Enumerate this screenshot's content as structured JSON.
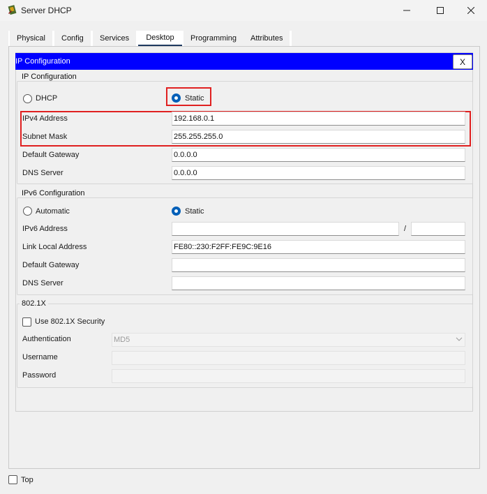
{
  "window": {
    "title": "Server DHCP"
  },
  "tabs": [
    {
      "label": "Physical"
    },
    {
      "label": "Config"
    },
    {
      "label": "Services"
    },
    {
      "label": "Desktop"
    },
    {
      "label": "Programming"
    },
    {
      "label": "Attributes"
    }
  ],
  "active_tab": "Desktop",
  "header": {
    "title": "IP Configuration",
    "close_label": "X"
  },
  "ipv4": {
    "group_title": "IP Configuration",
    "dhcp_label": "DHCP",
    "static_label": "Static",
    "selected": "Static",
    "ipv4_label": "IPv4 Address",
    "ipv4_value": "192.168.0.1",
    "subnet_label": "Subnet Mask",
    "subnet_value": "255.255.255.0",
    "gateway_label": "Default Gateway",
    "gateway_value": "0.0.0.0",
    "dns_label": "DNS Server",
    "dns_value": "0.0.0.0"
  },
  "ipv6": {
    "group_title": "IPv6 Configuration",
    "automatic_label": "Automatic",
    "static_label": "Static",
    "selected": "Static",
    "address_label": "IPv6 Address",
    "address_value": "",
    "prefix_separator": "/",
    "prefix_value": "",
    "link_local_label": "Link Local Address",
    "link_local_value": "FE80::230:F2FF:FE9C:9E16",
    "gateway_label": "Default Gateway",
    "gateway_value": "",
    "dns_label": "DNS Server",
    "dns_value": ""
  },
  "dot1x": {
    "group_title": "802.1X",
    "use_security_label": "Use 802.1X Security",
    "use_security_checked": false,
    "auth_label": "Authentication",
    "auth_value": "MD5",
    "username_label": "Username",
    "username_value": "",
    "password_label": "Password",
    "password_value": ""
  },
  "footer": {
    "top_label": "Top",
    "top_checked": false
  },
  "colors": {
    "header_bg": "#0000ff",
    "highlight": "#e02020",
    "radio_accent": "#005fb8"
  }
}
